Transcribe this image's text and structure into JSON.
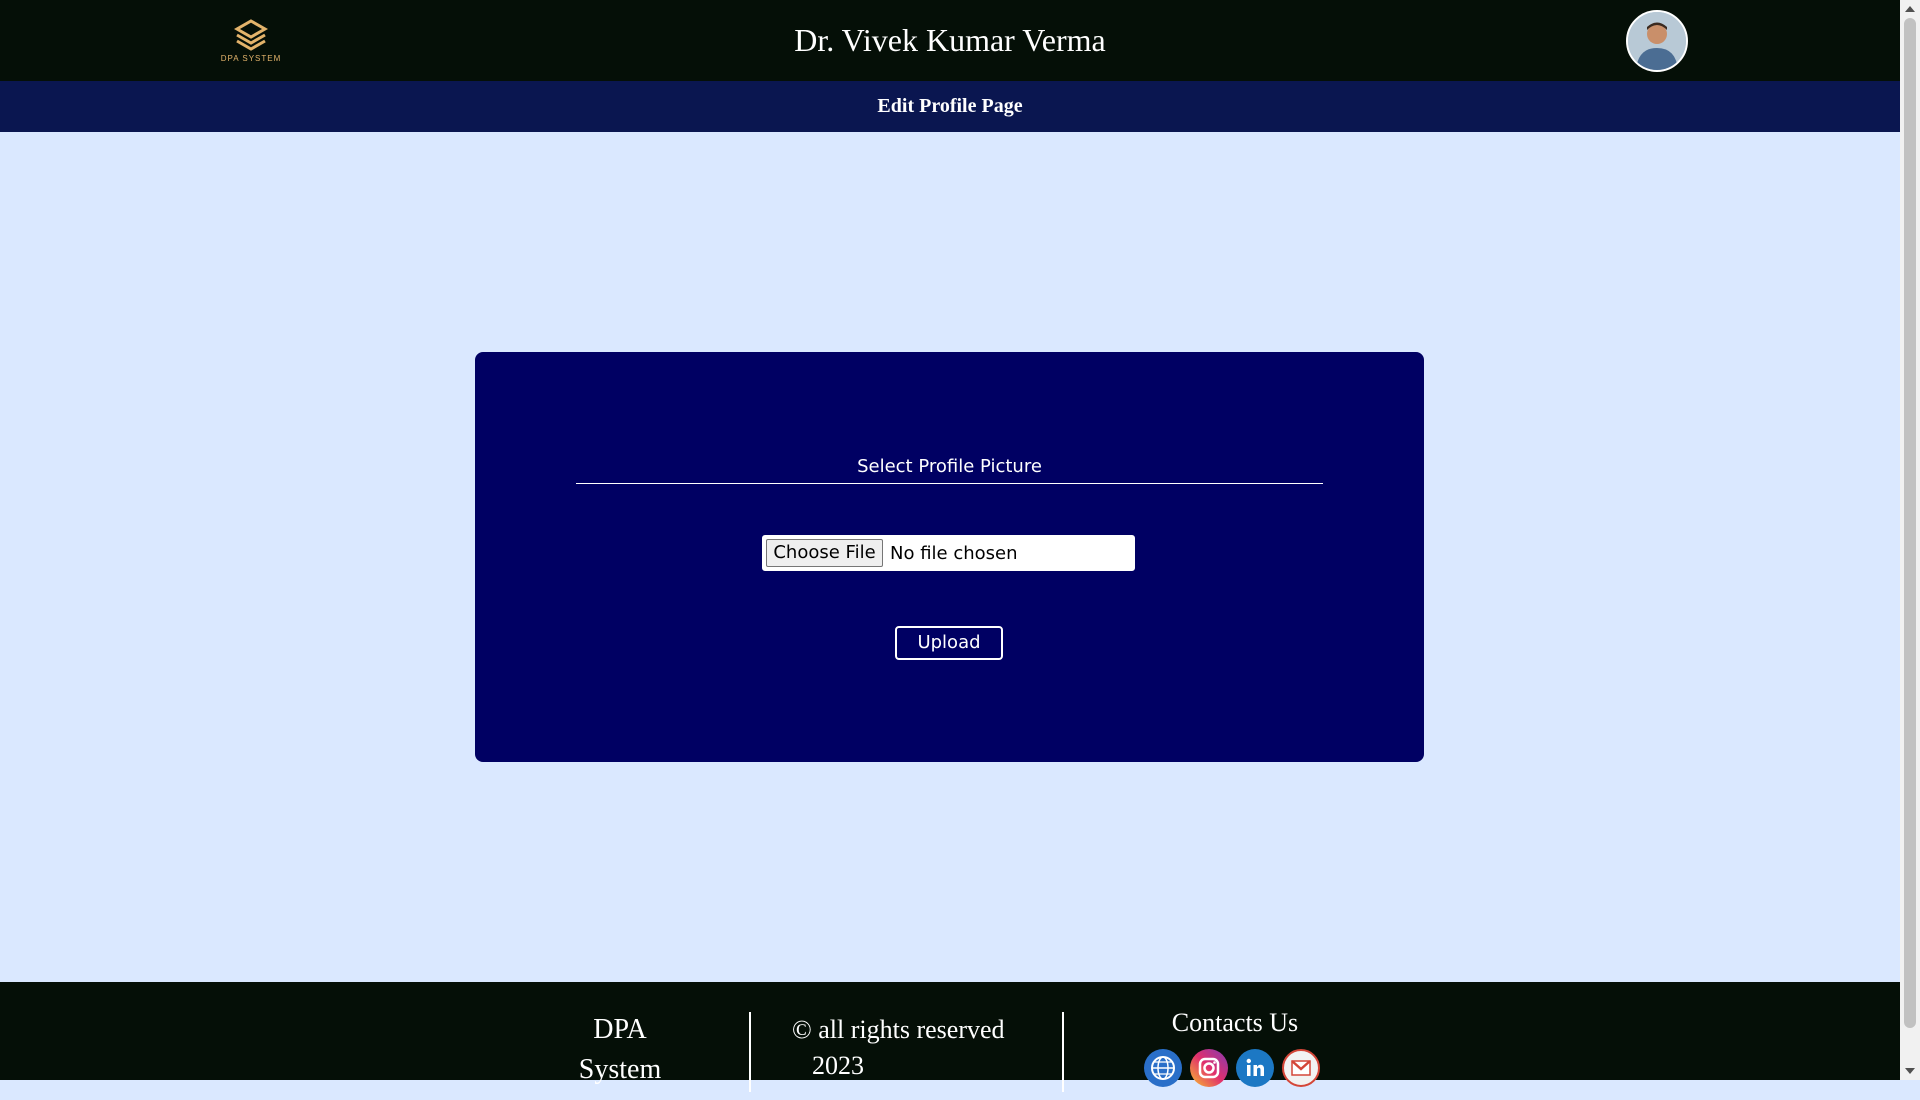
{
  "header": {
    "logo_text": "DPA SYSTEM",
    "title": "Dr. Vivek Kumar Verma",
    "avatar_icon": "user-avatar"
  },
  "subbar": {
    "label": "Edit Profile Page"
  },
  "form": {
    "label": "Select Profile Picture",
    "choose_button": "Choose File",
    "file_status": "No file chosen",
    "upload_button": "Upload"
  },
  "footer": {
    "brand_line1": "DPA",
    "brand_line2": "System",
    "copyright_line1": "© all rights reserved",
    "copyright_line2": "2023",
    "contacts_title": "Contacts Us",
    "social_icons": [
      "globe-icon",
      "instagram-icon",
      "linkedin-icon",
      "gmail-icon"
    ]
  },
  "colors": {
    "header_bg": "#050f07",
    "subbar_bg": "#0a1650",
    "page_bg": "#dae8ff",
    "card_bg": "#000063",
    "logo_gold": "#e3b36b"
  }
}
